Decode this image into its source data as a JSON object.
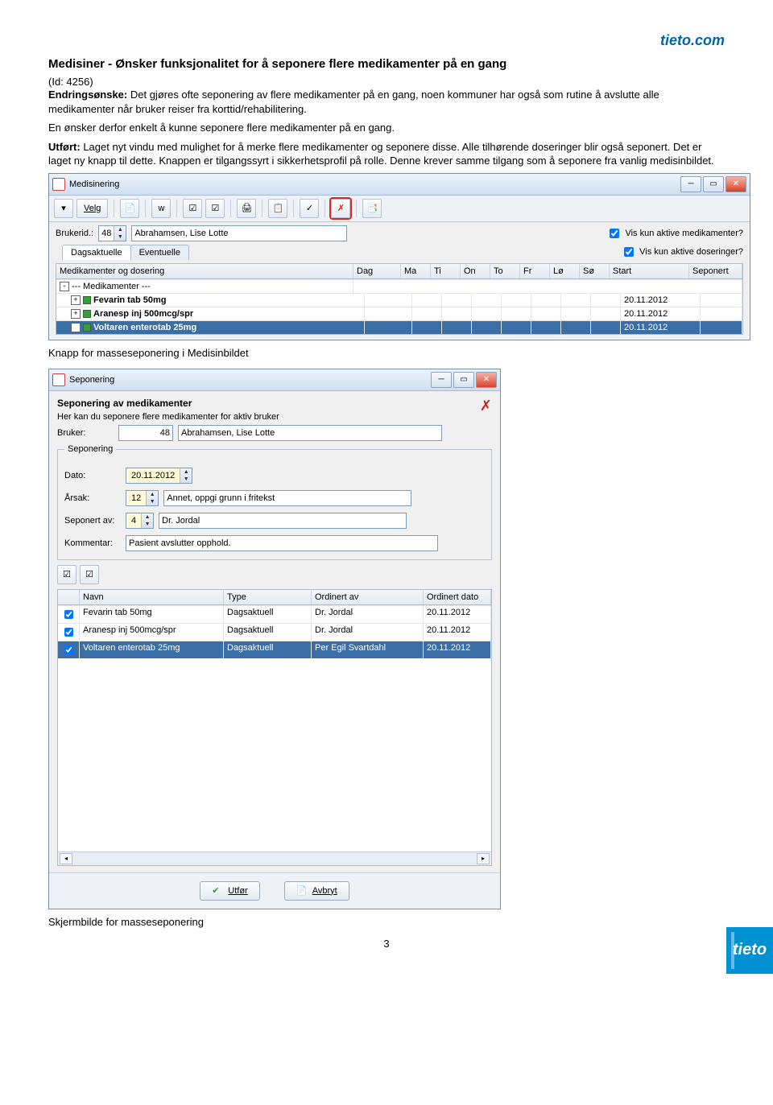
{
  "header_logo": "tieto.com",
  "title": "Medisiner - Ønsker funksjonalitet for å seponere flere medikamenter på en gang",
  "id_line": "(Id: 4256)",
  "p1_label": "Endringsønske:",
  "p1_text": " Det gjøres ofte seponering av flere medikamenter på en gang, noen kommuner har også som rutine å avslutte alle medikamenter når bruker reiser fra korttid/rehabilitering.",
  "p2_text": "En ønsker derfor enkelt å kunne seponere flere medikamenter på en gang.",
  "p3_label": "Utført:",
  "p3_text": " Laget nyt vindu med mulighet for å merke flere medikamenter og seponere disse. Alle tilhørende doseringer blir også seponert. Det er laget ny knapp til dette. Knappen er tilgangssyrt i sikkerhetsprofil på rolle. Denne krever samme tilgang som å seponere fra vanlig medisinbildet.",
  "medwin": {
    "title": "Medisinering",
    "velg": "Velg",
    "brukerid_label": "Brukerid.:",
    "brukerid": "48",
    "bruker_name": "Abrahamsen, Lise Lotte",
    "chk1": "Vis kun aktive medikamenter?",
    "chk2": "Vis kun aktive doseringer?",
    "tabs": {
      "t1": "Dagsaktuelle",
      "t2": "Eventuelle"
    },
    "cols": {
      "c0": "Medikamenter og dosering",
      "c1": "Dag",
      "c2": "Ma",
      "c3": "Ti",
      "c4": "On",
      "c5": "To",
      "c6": "Fr",
      "c7": "Lø",
      "c8": "Sø",
      "c9": "Start",
      "c10": "Seponert"
    },
    "rowhdr": "--- Medikamenter ---",
    "rows": [
      {
        "name": "Fevarin tab 50mg",
        "start": "20.11.2012",
        "sel": false
      },
      {
        "name": "Aranesp inj 500mcg/spr",
        "start": "20.11.2012",
        "sel": false
      },
      {
        "name": "Voltaren enterotab 25mg",
        "start": "20.11.2012",
        "sel": true
      }
    ]
  },
  "caption1": "Knapp for masseseponering i Medisinbildet",
  "sepwin": {
    "title": "Seponering",
    "heading": "Seponering av medikamenter",
    "sub": "Her kan du seponere flere medikamenter for aktiv bruker",
    "bruker_label": "Bruker:",
    "bruker_id": "48",
    "bruker_name": "Abrahamsen, Lise Lotte",
    "fs_label": "Seponering",
    "dato_label": "Dato:",
    "dato": "20.11.2012",
    "arsak_label": "Årsak:",
    "arsak_id": "12",
    "arsak_text": "Annet, oppgi grunn i fritekst",
    "seponert_label": "Seponert av:",
    "seponert_id": "4",
    "seponert_text": "Dr. Jordal",
    "kommentar_label": "Kommentar:",
    "kommentar": "Pasient avslutter opphold.",
    "cols": {
      "c0": "Navn",
      "c1": "Type",
      "c2": "Ordinert av",
      "c3": "Ordinert dato"
    },
    "rows": [
      {
        "n": "Fevarin tab 50mg",
        "t": "Dagsaktuell",
        "o": "Dr. Jordal",
        "d": "20.11.2012",
        "sel": false
      },
      {
        "n": "Aranesp inj 500mcg/spr",
        "t": "Dagsaktuell",
        "o": "Dr. Jordal",
        "d": "20.11.2012",
        "sel": false
      },
      {
        "n": "Voltaren enterotab 25mg",
        "t": "Dagsaktuell",
        "o": "Per Egil Svartdahl",
        "d": "20.11.2012",
        "sel": true
      }
    ],
    "btn_ok": "Utfør",
    "btn_cancel": "Avbryt"
  },
  "caption2": "Skjermbilde for masseseponering",
  "pagenum": "3"
}
